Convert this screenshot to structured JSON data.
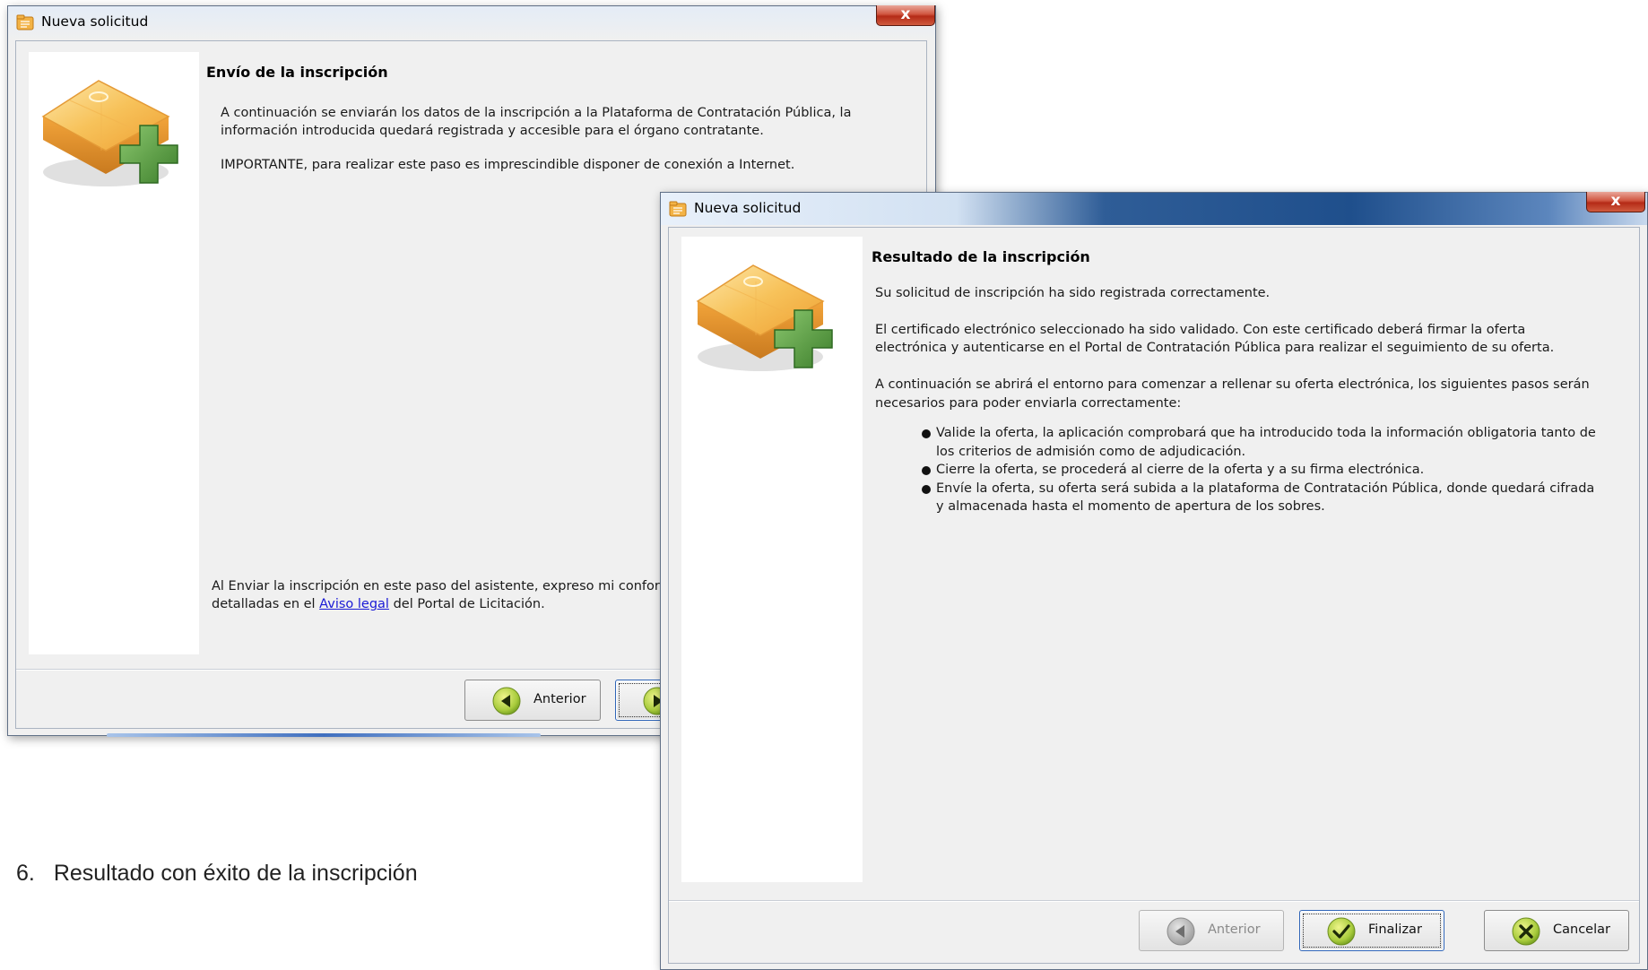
{
  "back_window": {
    "title": "Nueva solicitud",
    "close_label": "x",
    "heading": "Envío de la inscripción",
    "intro_line1": "A continuación se enviarán los datos de la inscripción a la Plataforma de Contratación Pública, la",
    "intro_line2": "información introducida quedará registrada y accesible para el órgano contratante.",
    "important": "IMPORTANTE, para realizar este paso es imprescindible disponer de conexión a Internet.",
    "legal_line1": "Al Enviar la inscripción en este paso del asistente, expreso mi conformid",
    "legal_line2_pre": "detalladas en el ",
    "legal_link": "Aviso legal",
    "legal_line2_post": " del Portal de Licitación.",
    "buttons": {
      "anterior": "Anterior"
    }
  },
  "front_window": {
    "title": "Nueva solicitud",
    "close_label": "x",
    "heading": "Resultado de la inscripción",
    "p1": "Su solicitud de inscripción ha sido registrada correctamente.",
    "p2_line1": "El certificado electrónico seleccionado ha sido validado. Con este certificado deberá firmar la oferta",
    "p2_line2": "electrónica y autenticarse en el Portal de Contratación Pública para realizar el seguimiento de su oferta.",
    "p3_line1": "A continuación se abrirá el entorno para comenzar a rellenar su oferta electrónica, los siguientes pasos serán",
    "p3_line2": "necesarios para poder enviarla correctamente:",
    "bullets": [
      {
        "line1": "Valide la oferta, la aplicación comprobará que ha introducido toda la información obligatoria tanto de",
        "line2": "los criterios de admisión como de adjudicación."
      },
      {
        "line1": "Cierre la oferta, se procederá al cierre de la oferta y a su firma electrónica.",
        "line2": ""
      },
      {
        "line1": "Envíe la oferta, su oferta será subida a la plataforma de Contratación Pública, donde quedará cifrada",
        "line2": "y almacenada hasta el momento de apertura de los sobres."
      }
    ],
    "buttons": {
      "anterior": "Anterior",
      "finalizar": "Finalizar",
      "cancelar": "Cancelar"
    }
  },
  "caption": {
    "number": "6.",
    "text": "Resultado con éxito de la inscripción"
  },
  "colors": {
    "box_orange": "#f0a43a",
    "plus_green": "#4f9a3b",
    "link_blue": "#1a1ad6",
    "close_red": "#c8452e"
  }
}
